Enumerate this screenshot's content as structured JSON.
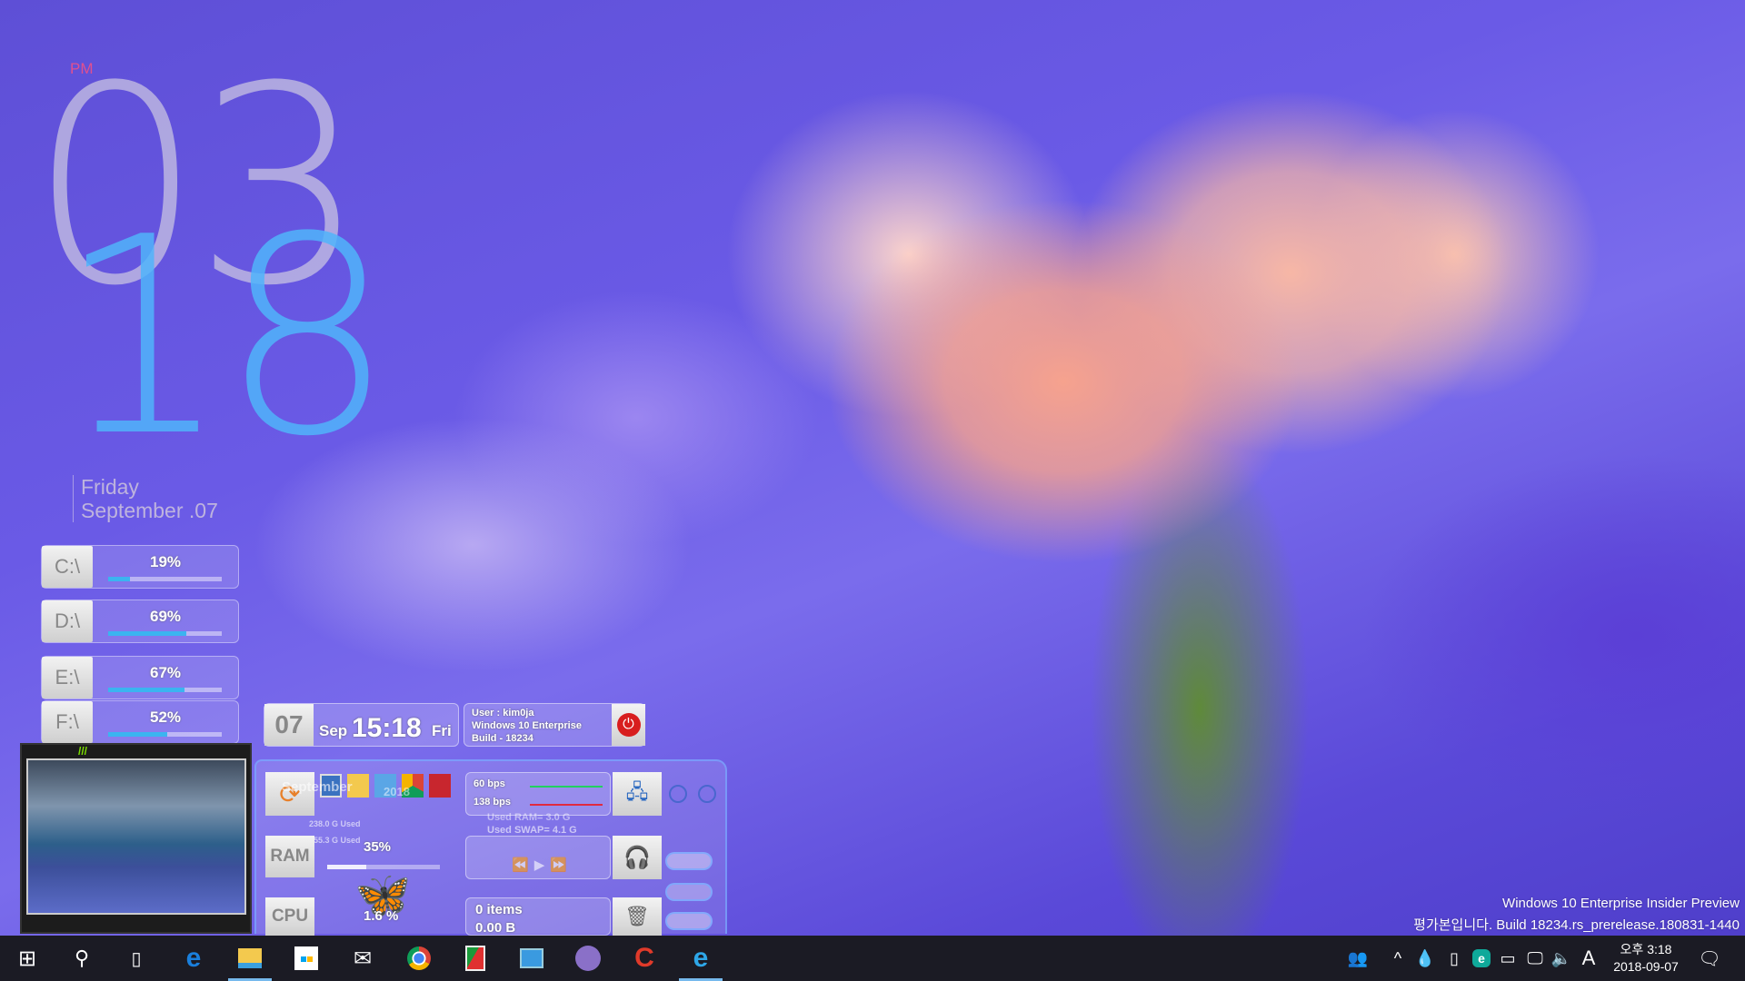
{
  "clock": {
    "ampm": "PM",
    "hour": "03",
    "minute": "18",
    "weekday": "Friday",
    "date": "September .07"
  },
  "drives": [
    {
      "label": "C:\\",
      "percent": 19
    },
    {
      "label": "D:\\",
      "percent": 69
    },
    {
      "label": "E:\\",
      "percent": 67
    },
    {
      "label": "F:\\",
      "percent": 52
    }
  ],
  "date_widget": {
    "day": "07",
    "month": "Sep",
    "time": "15:18",
    "weekday": "Fri"
  },
  "user_widget": {
    "user": "User : kim0ja",
    "os": "Windows 10 Enterprise",
    "build": "Build - 18234"
  },
  "panel": {
    "month": "September",
    "year": "2018",
    "net_up": "60 bps",
    "net_down": "138 bps",
    "used_ram": "Used RAM= 3.0 G",
    "used_swap": "Used SWAP= 4.1 G",
    "disk1": "238.0 G Used",
    "disk2": "155.3 G Used",
    "ram_label": "RAM",
    "ram_pct": "35%",
    "ram_value": 35,
    "cpu_label": "CPU",
    "cpu_pct": "1.6 %",
    "cpu_value": 1.6,
    "recycle_items": "0 items",
    "recycle_size": "0.00 B"
  },
  "watermark": {
    "line1": "Windows 10 Enterprise Insider Preview",
    "line2": "평가본입니다. Build 18234.rs_prerelease.180831-1440"
  },
  "taskbar": {
    "apps": [
      "start",
      "search",
      "task-view",
      "edge",
      "file-explorer",
      "store",
      "mail",
      "chrome",
      "app-red-green",
      "control-panel",
      "tor-browser",
      "ccleaner",
      "internet-explorer"
    ],
    "active": [
      "file-explorer",
      "internet-explorer"
    ]
  },
  "tray": {
    "time": "오후 3:18",
    "date": "2018-09-07",
    "ime": "A",
    "eset": "e"
  },
  "colors": {
    "taskbar": "#1b1b24",
    "accent": "#76b9ed",
    "drive_bar": "#3bb4f0",
    "clock_minute": "#50b4fa",
    "pm": "#e0508f"
  }
}
